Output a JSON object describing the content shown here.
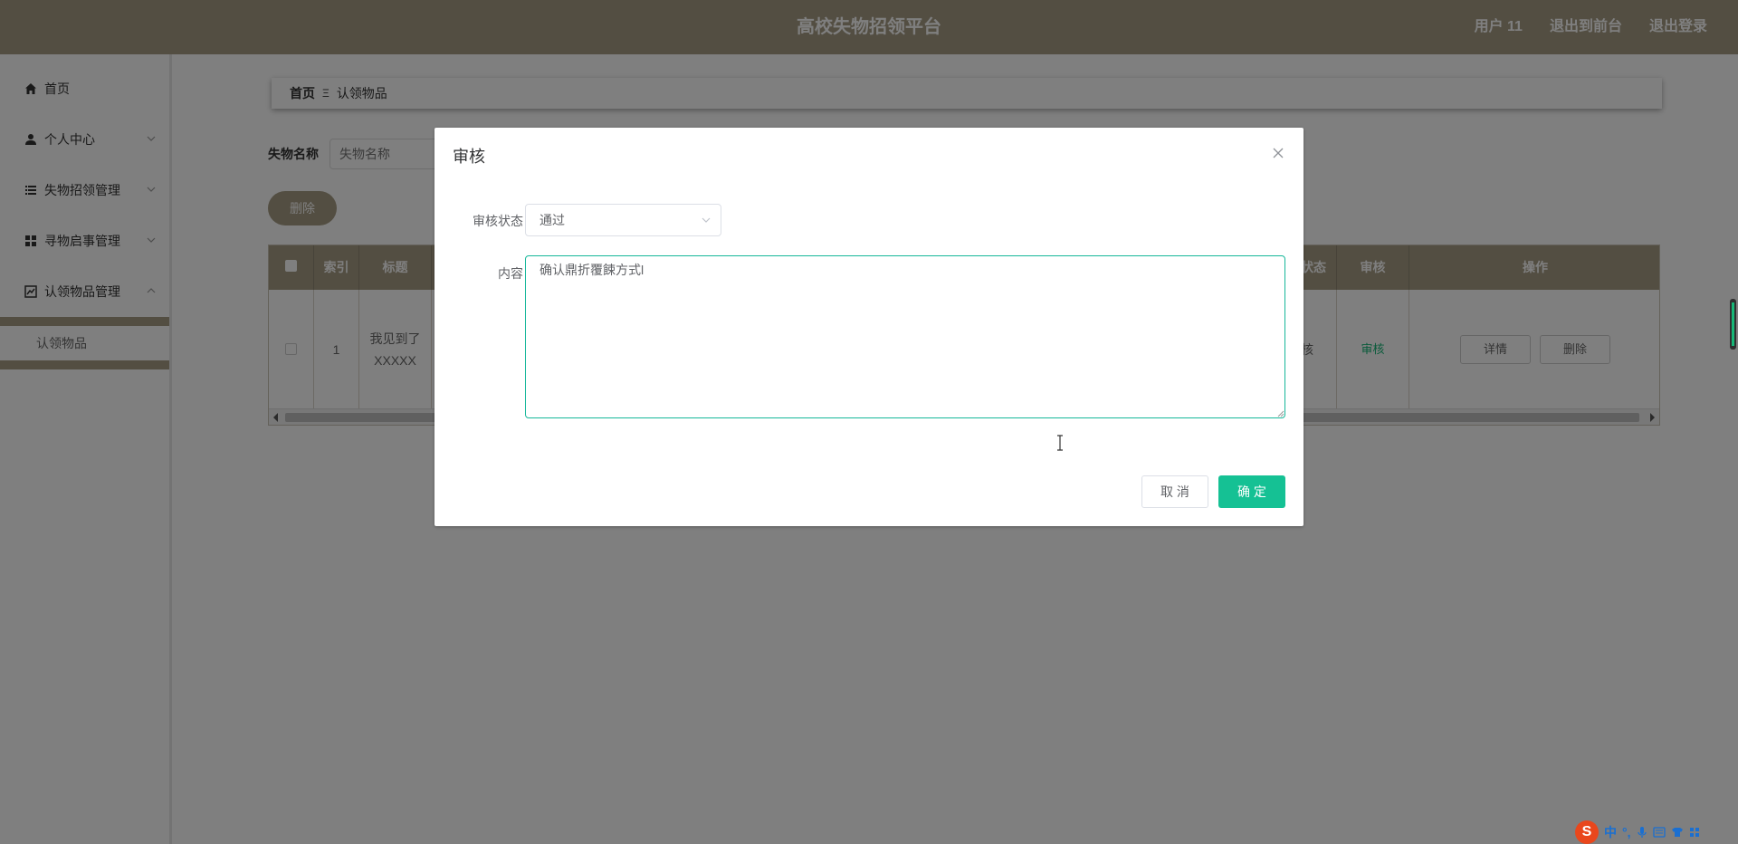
{
  "header": {
    "title": "高校失物招领平台",
    "user": "用户 11",
    "to_front": "退出到前台",
    "logout": "退出登录"
  },
  "sidebar": {
    "items": [
      {
        "label": "首页",
        "icon": "home-icon"
      },
      {
        "label": "个人中心",
        "icon": "user-icon"
      },
      {
        "label": "失物招领管理",
        "icon": "list-icon"
      },
      {
        "label": "寻物启事管理",
        "icon": "grid-icon"
      },
      {
        "label": "认领物品管理",
        "icon": "chart-icon"
      }
    ],
    "submenu": {
      "label": "认领物品"
    }
  },
  "breadcrumb": {
    "home": "首页",
    "separator": "Ξ",
    "current": "认领物品"
  },
  "search": {
    "label": "失物名称",
    "placeholder": "失物名称"
  },
  "toolbar": {
    "delete_label": "删除"
  },
  "table": {
    "headers": {
      "index": "索引",
      "title": "标题",
      "status": "状态",
      "audit": "审核",
      "actions": "操作"
    },
    "rows": [
      {
        "index": "1",
        "title": "我见到了XXXXX",
        "status": "核",
        "audit": "审核",
        "detail": "详情",
        "delete": "删除"
      }
    ]
  },
  "dialog": {
    "title": "审核",
    "status_label": "审核状态",
    "status_value": "通过",
    "content_label": "内容",
    "content_value": "确认鼎折覆餗方式l",
    "cancel": "取 消",
    "confirm": "确 定"
  },
  "ime": {
    "chars": [
      "中",
      "°,"
    ]
  },
  "colors": {
    "header_bg": "#a69c84",
    "accent_green": "#15c194",
    "overlay": "rgba(0,0,0,0.5)"
  }
}
